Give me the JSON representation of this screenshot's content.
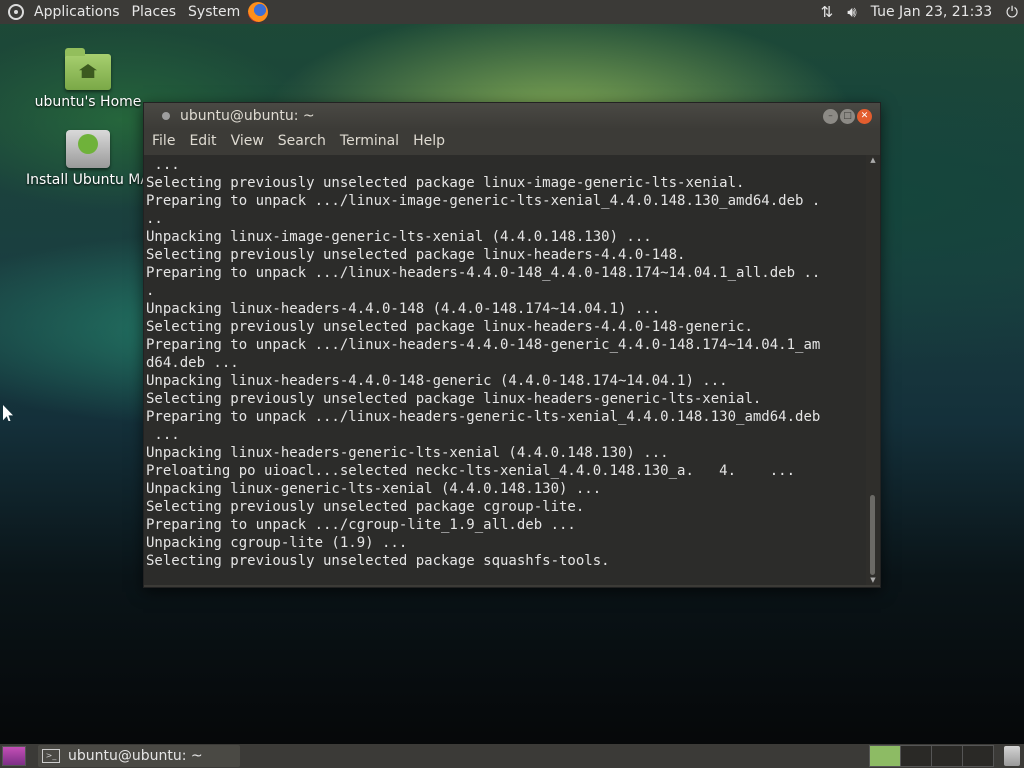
{
  "top_panel": {
    "menus": [
      "Applications",
      "Places",
      "System"
    ],
    "datetime": "Tue Jan 23, 21:33"
  },
  "desktop_icons": [
    {
      "label": "ubuntu's Home"
    },
    {
      "label": "Install Ubuntu MA"
    }
  ],
  "terminal": {
    "title": "ubuntu@ubuntu: ~",
    "menu": [
      "File",
      "Edit",
      "View",
      "Search",
      "Terminal",
      "Help"
    ],
    "lines": [
      " ...",
      "Selecting previously unselected package linux-image-generic-lts-xenial.",
      "Preparing to unpack .../linux-image-generic-lts-xenial_4.4.0.148.130_amd64.deb .",
      "..",
      "Unpacking linux-image-generic-lts-xenial (4.4.0.148.130) ...",
      "Selecting previously unselected package linux-headers-4.4.0-148.",
      "Preparing to unpack .../linux-headers-4.4.0-148_4.4.0-148.174~14.04.1_all.deb ..",
      ".",
      "Unpacking linux-headers-4.4.0-148 (4.4.0-148.174~14.04.1) ...",
      "Selecting previously unselected package linux-headers-4.4.0-148-generic.",
      "Preparing to unpack .../linux-headers-4.4.0-148-generic_4.4.0-148.174~14.04.1_am",
      "d64.deb ...",
      "Unpacking linux-headers-4.4.0-148-generic (4.4.0-148.174~14.04.1) ...",
      "Selecting previously unselected package linux-headers-generic-lts-xenial.",
      "Preparing to unpack .../linux-headers-generic-lts-xenial_4.4.0.148.130_amd64.deb",
      " ...",
      "Unpacking linux-headers-generic-lts-xenial (4.4.0.148.130) ...",
      "Preloating po uioacl...selected neckc-lts-xenial_4.4.0.148.130_a.   4.    ...",
      "Unpacking linux-generic-lts-xenial (4.4.0.148.130) ...",
      "Selecting previously unselected package cgroup-lite.",
      "Preparing to unpack .../cgroup-lite_1.9_all.deb ...",
      "Unpacking cgroup-lite (1.9) ...",
      "Selecting previously unselected package squashfs-tools."
    ]
  },
  "bottom_panel": {
    "task_label": "ubuntu@ubuntu: ~"
  },
  "icons": {
    "logo": "ubuntu-logo-icon",
    "browser": "firefox-icon",
    "network": "network-arrows-icon",
    "volume": "volume-icon",
    "power": "power-icon",
    "trash": "trash-icon"
  }
}
